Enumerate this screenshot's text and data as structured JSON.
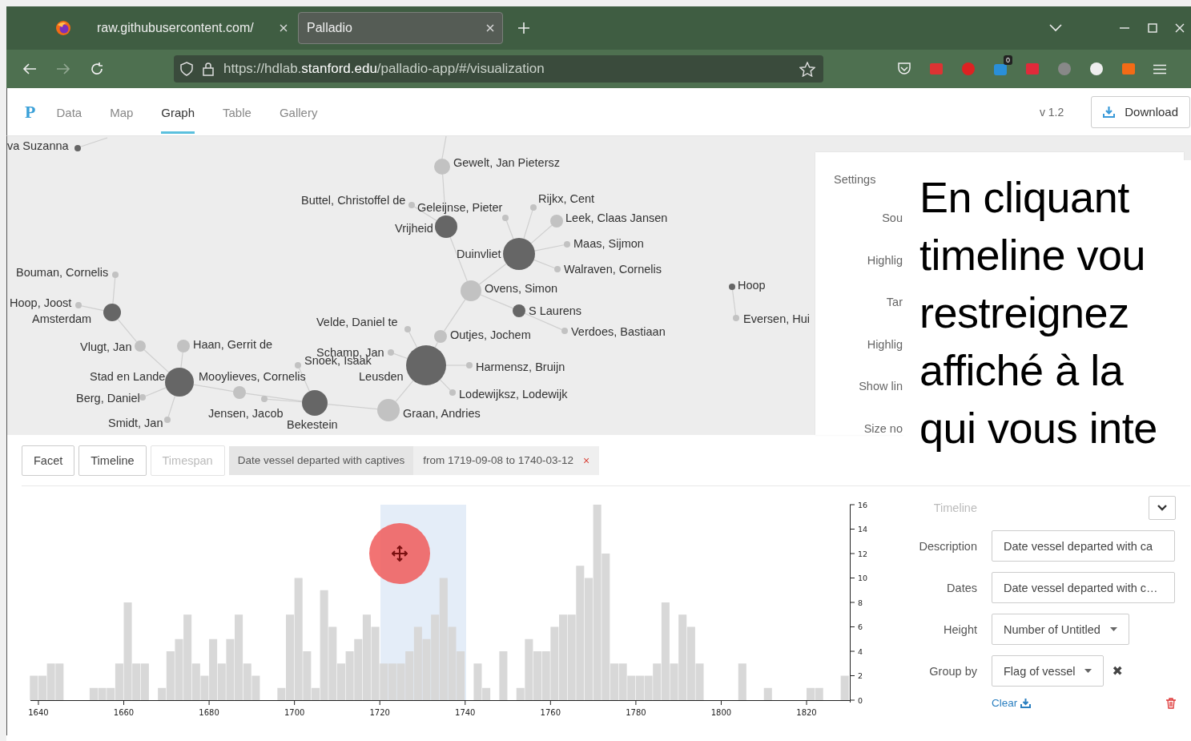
{
  "browser": {
    "tabs": [
      {
        "title": "raw.githubusercontent.com/",
        "selected": false
      },
      {
        "title": "Palladio",
        "selected": true
      }
    ],
    "url": {
      "prefix": "https://hdlab.",
      "domain": "stanford.edu",
      "path": "/palladio-app/#/visualization"
    },
    "extension_badge": "0"
  },
  "app": {
    "logo": "P",
    "nav": [
      {
        "label": "Data",
        "selected": false
      },
      {
        "label": "Map",
        "selected": false
      },
      {
        "label": "Graph",
        "selected": true
      },
      {
        "label": "Table",
        "selected": false
      },
      {
        "label": "Gallery",
        "selected": false
      }
    ],
    "version": "v 1.2",
    "download": "Download"
  },
  "graph": {
    "nodes": [
      {
        "label": "va Suzanna",
        "kind": "source"
      },
      {
        "label": "Gewelt, Jan Pietersz",
        "kind": "target"
      },
      {
        "label": "Buttel, Christoffel de",
        "kind": "target"
      },
      {
        "label": "Vrijheid",
        "kind": "source"
      },
      {
        "label": "Geleijnse, Pieter",
        "kind": "target"
      },
      {
        "label": "Rijkx, Cent",
        "kind": "target"
      },
      {
        "label": "Leek, Claas Jansen",
        "kind": "target"
      },
      {
        "label": "Duinvliet",
        "kind": "source"
      },
      {
        "label": "Maas, Sijmon",
        "kind": "target"
      },
      {
        "label": "Walraven, Cornelis",
        "kind": "target"
      },
      {
        "label": "Ovens, Simon",
        "kind": "target"
      },
      {
        "label": "S Laurens",
        "kind": "source"
      },
      {
        "label": "Verdoes, Bastiaan",
        "kind": "target"
      },
      {
        "label": "Hoop",
        "kind": "source"
      },
      {
        "label": "Eversen, Hui",
        "kind": "target"
      },
      {
        "label": "Bouman, Cornelis",
        "kind": "target"
      },
      {
        "label": "Hoop, Joost",
        "kind": "target"
      },
      {
        "label": "Amsterdam",
        "kind": "source"
      },
      {
        "label": "Vlugt, Jan",
        "kind": "target"
      },
      {
        "label": "Haan, Gerrit de",
        "kind": "target"
      },
      {
        "label": "Stad en Lande",
        "kind": "source"
      },
      {
        "label": "Mooylieves, Cornelis",
        "kind": "target"
      },
      {
        "label": "Berg, Daniel",
        "kind": "target"
      },
      {
        "label": "Jensen, Jacob",
        "kind": "target"
      },
      {
        "label": "Bekestein",
        "kind": "source"
      },
      {
        "label": "Smidt, Jan",
        "kind": "target"
      },
      {
        "label": "Snoek, Isaak",
        "kind": "target"
      },
      {
        "label": "Graan, Andries",
        "kind": "target"
      },
      {
        "label": "Velde, Daniel te",
        "kind": "target"
      },
      {
        "label": "Schamp, Jan",
        "kind": "target"
      },
      {
        "label": "Outjes, Jochem",
        "kind": "target"
      },
      {
        "label": "Leusden",
        "kind": "source"
      },
      {
        "label": "Harmensz, Bruijn",
        "kind": "target"
      },
      {
        "label": "Lodewijksz, Lodewijk",
        "kind": "target"
      }
    ]
  },
  "settings": {
    "title": "Settings",
    "labels": [
      "Sou",
      "Highlig",
      "Tar",
      "Highlig",
      "Show lin",
      "Size no"
    ]
  },
  "caption": {
    "lines": [
      "En cliquant",
      "timeline vou",
      "restreignez",
      "affiché à la",
      "qui vous inte"
    ]
  },
  "timeline": {
    "buttons": [
      {
        "label": "Facet",
        "disabled": false
      },
      {
        "label": "Timeline",
        "disabled": false
      },
      {
        "label": "Timespan",
        "disabled": true
      }
    ],
    "filter": {
      "field": "Date vessel departed with captives",
      "range": "from 1719-09-08 to 1740-03-12",
      "remove": "×"
    },
    "chart_data": {
      "type": "bar",
      "x": [
        1638,
        1640,
        1642,
        1644,
        1646,
        1648,
        1650,
        1652,
        1654,
        1656,
        1658,
        1660,
        1662,
        1664,
        1666,
        1668,
        1670,
        1672,
        1674,
        1676,
        1678,
        1680,
        1682,
        1684,
        1686,
        1688,
        1690,
        1692,
        1694,
        1696,
        1698,
        1700,
        1702,
        1704,
        1706,
        1708,
        1710,
        1712,
        1714,
        1716,
        1718,
        1720,
        1722,
        1724,
        1726,
        1728,
        1730,
        1732,
        1734,
        1736,
        1738,
        1740,
        1742,
        1744,
        1746,
        1748,
        1750,
        1752,
        1754,
        1756,
        1758,
        1760,
        1762,
        1764,
        1766,
        1768,
        1770,
        1772,
        1774,
        1776,
        1778,
        1780,
        1782,
        1784,
        1786,
        1788,
        1790,
        1792,
        1794,
        1796,
        1798,
        1800,
        1802,
        1804,
        1806,
        1808,
        1810,
        1812,
        1814,
        1816,
        1818,
        1820,
        1822,
        1824,
        1826,
        1828
      ],
      "values": [
        2,
        2,
        3,
        3,
        0,
        0,
        0,
        1,
        1,
        1,
        3,
        8,
        3,
        3,
        0,
        1,
        4,
        5,
        7,
        3,
        2,
        5,
        3,
        5,
        7,
        3,
        2,
        0,
        0,
        1,
        7,
        10,
        4,
        1,
        9,
        6,
        3,
        4,
        5,
        7,
        6,
        3,
        3,
        3,
        4,
        6,
        5,
        7,
        10,
        6,
        4,
        0,
        3,
        1,
        0,
        4,
        0,
        1,
        5,
        4,
        4,
        6,
        7,
        7,
        11,
        10,
        16,
        12,
        3,
        3,
        2,
        2,
        2,
        3,
        8,
        3,
        7,
        6,
        3,
        0,
        0,
        0,
        0,
        3,
        0,
        0,
        1,
        0,
        0,
        0,
        0,
        1,
        1,
        0,
        0,
        2
      ],
      "xticks": [
        1640,
        1660,
        1680,
        1700,
        1720,
        1740,
        1760,
        1780,
        1800,
        1820
      ],
      "yticks": [
        0,
        2,
        4,
        6,
        8,
        10,
        12,
        14,
        16
      ],
      "xlim": [
        1638,
        1830
      ],
      "ylim": [
        0,
        16
      ]
    },
    "panel_title": "Timeline",
    "form": [
      {
        "label": "Description",
        "kind": "input",
        "value": "Date vessel departed with ca"
      },
      {
        "label": "Dates",
        "kind": "input",
        "value": "Date vessel departed with c…"
      },
      {
        "label": "Height",
        "kind": "dropdown",
        "value": "Number of Untitled",
        "removable": false
      },
      {
        "label": "Group by",
        "kind": "dropdown",
        "value": "Flag of vessel",
        "removable": true,
        "remove": "✖"
      }
    ],
    "clear": "Clear"
  }
}
